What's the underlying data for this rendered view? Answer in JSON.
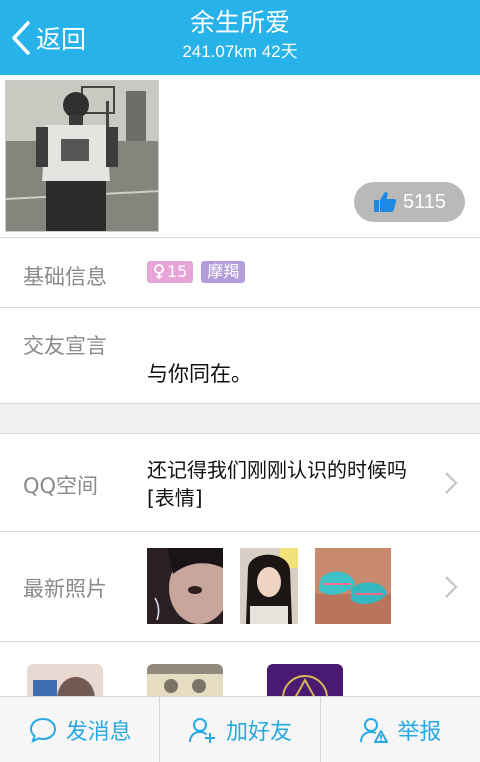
{
  "header": {
    "back_label": "返回",
    "title": "余生所爱",
    "subtitle": "241.07km 42天",
    "bg_color": "#27b3ea"
  },
  "profile": {
    "avatar_icon": "portrait-photo",
    "like_count": "5115",
    "like_icon": "thumbs-up-icon"
  },
  "basic_info": {
    "label": "基础信息",
    "gender_tag": "15",
    "gender_icon": "female-icon",
    "zodiac_tag": "摩羯"
  },
  "motto": {
    "label": "交友宣言",
    "text": "与你同在。"
  },
  "qzone": {
    "label": "QQ空间",
    "text": "还记得我们刚刚认识的时候吗 [表情]"
  },
  "photos": {
    "label": "最新照片",
    "items": [
      "photo-1",
      "photo-2",
      "photo-3"
    ]
  },
  "bottom_bar": {
    "message_label": "发消息",
    "add_friend_label": "加好友",
    "report_label": "举报",
    "accent_color": "#27a9e1"
  }
}
